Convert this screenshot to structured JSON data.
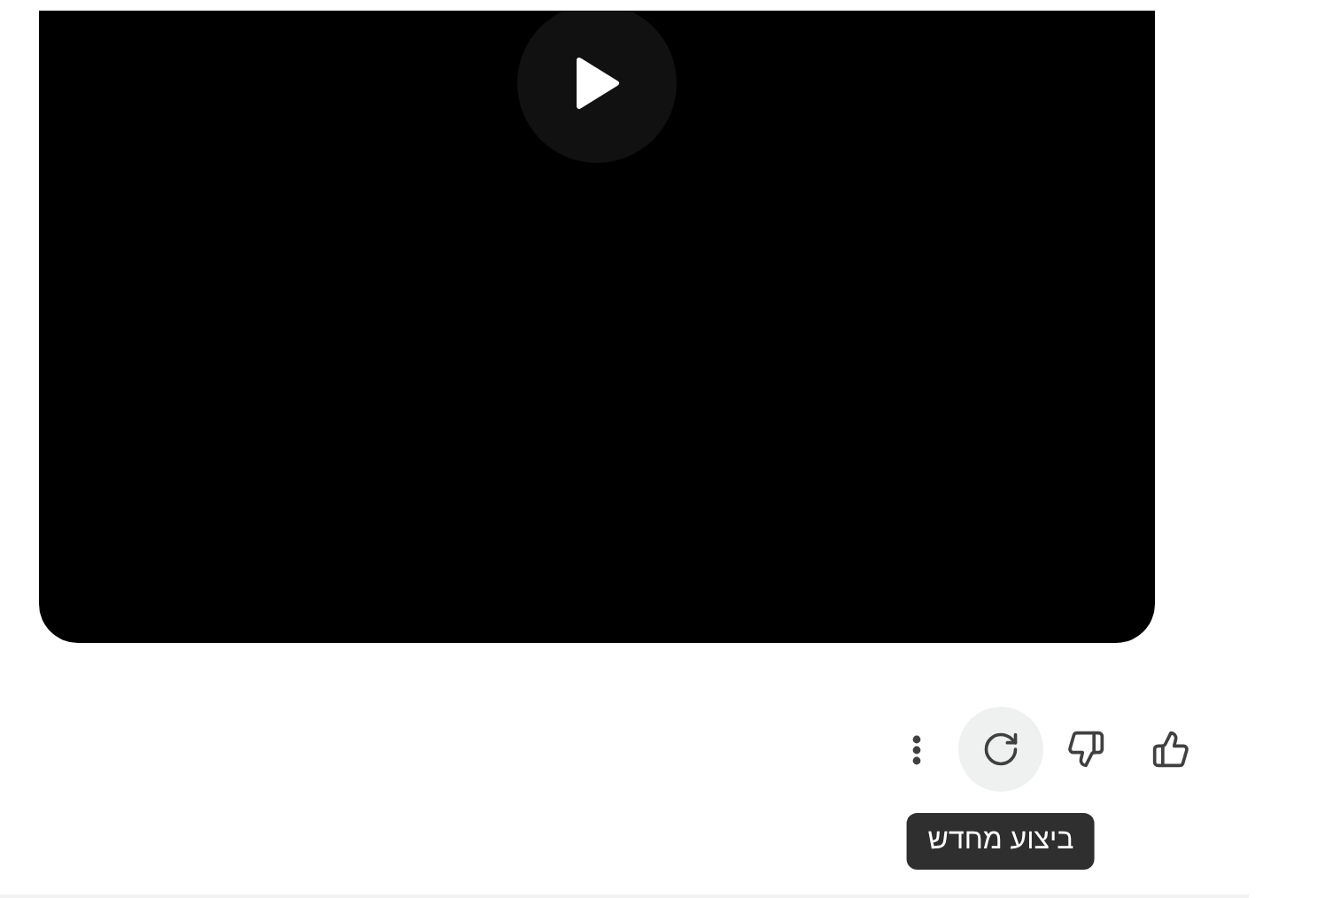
{
  "actions": [
    {
      "kind": "more",
      "hovered": false
    },
    {
      "kind": "regenerate",
      "hovered": true,
      "tooltip": "ביצוע מחדש"
    },
    {
      "kind": "dislike",
      "hovered": false
    },
    {
      "kind": "like",
      "hovered": false
    }
  ]
}
